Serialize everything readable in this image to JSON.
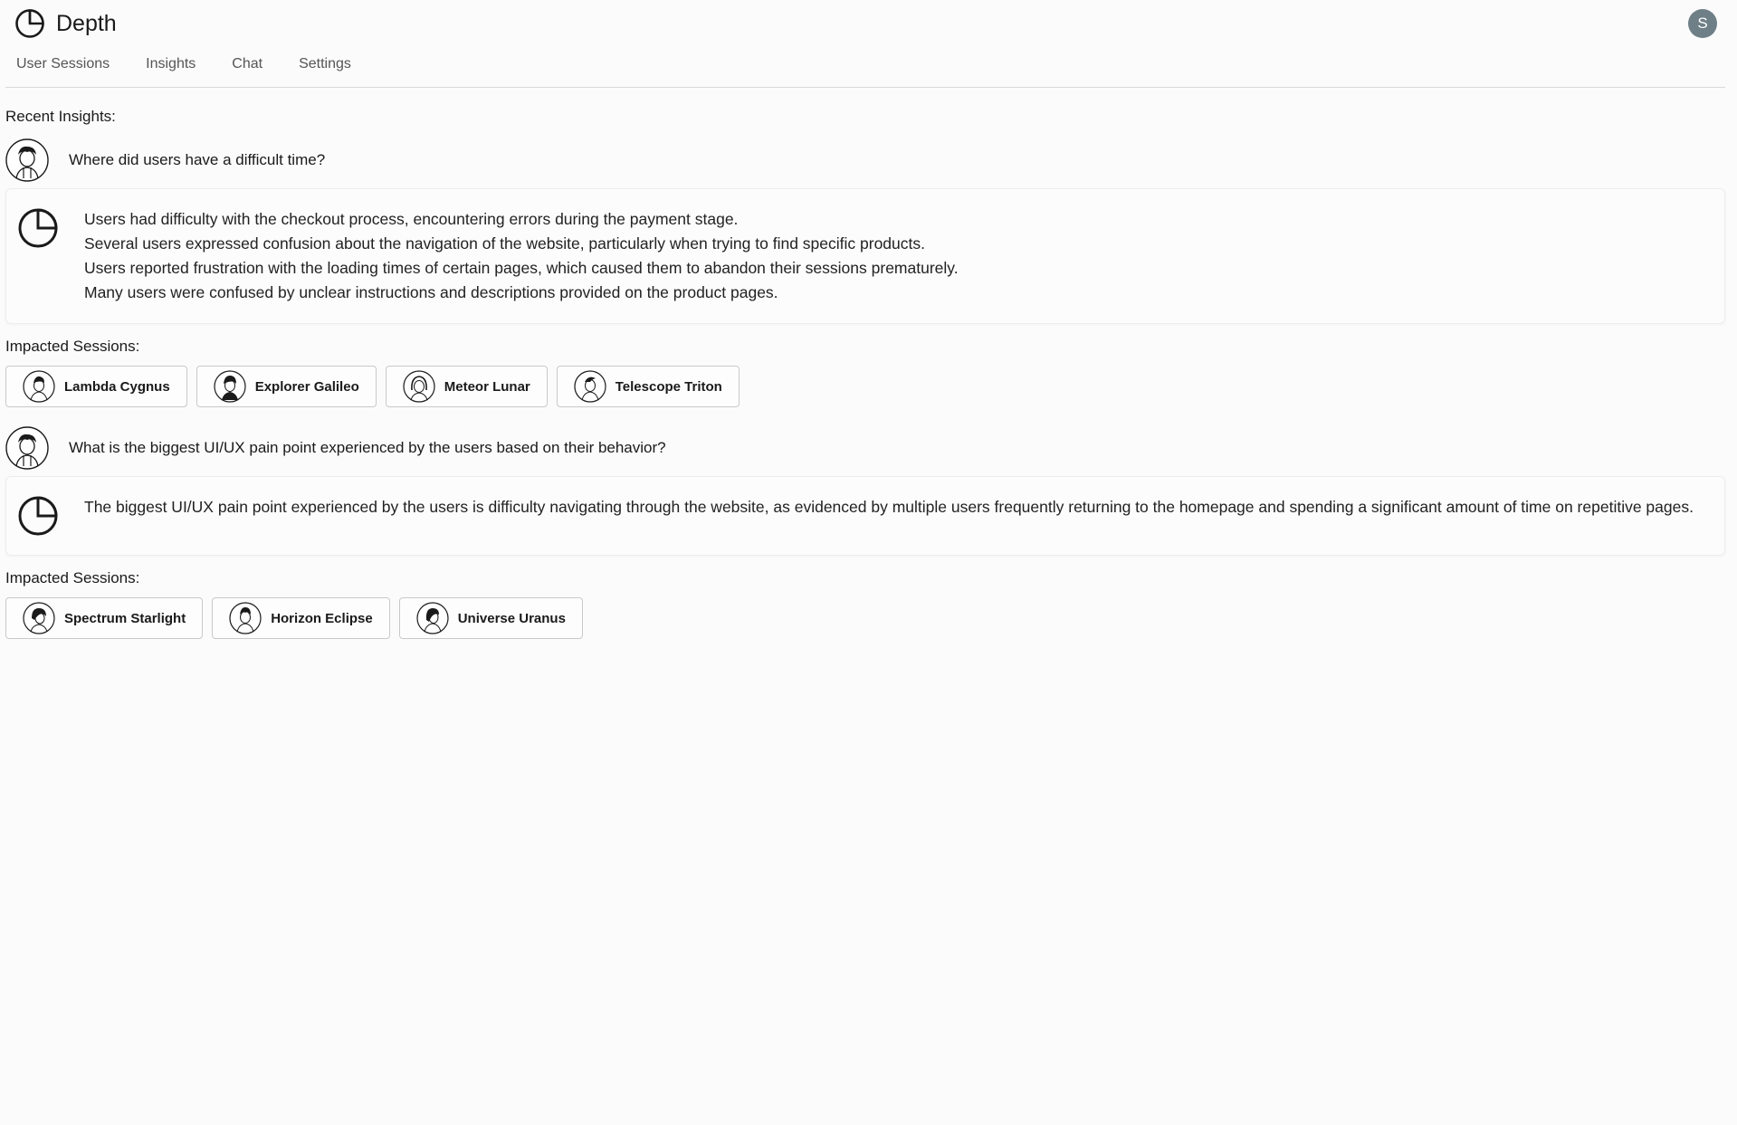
{
  "app": {
    "name": "Depth",
    "user_initial": "S"
  },
  "tabs": [
    {
      "label": "User Sessions"
    },
    {
      "label": "Insights"
    },
    {
      "label": "Chat"
    },
    {
      "label": "Settings"
    }
  ],
  "main": {
    "recent_label": "Recent Insights:",
    "insights": [
      {
        "question": "Where did users have a difficult time?",
        "answer_lines": [
          "Users had difficulty with the checkout process, encountering errors during the payment stage.",
          "Several users expressed confusion about the navigation of the website, particularly when trying to find specific products.",
          "Users reported frustration with the loading times of certain pages, which caused them to abandon their sessions prematurely.",
          "Many users were confused by unclear instructions and descriptions provided on the product pages."
        ],
        "impacted_label": "Impacted Sessions:",
        "sessions": [
          {
            "name": "Lambda Cygnus"
          },
          {
            "name": "Explorer Galileo"
          },
          {
            "name": "Meteor Lunar"
          },
          {
            "name": "Telescope Triton"
          }
        ]
      },
      {
        "question": "What is the biggest UI/UX pain point experienced by the users based on their behavior?",
        "answer_lines": [
          "The biggest UI/UX pain point experienced by the users is difficulty navigating through the website, as evidenced by multiple users frequently returning to the homepage and spending a significant amount of time on repetitive pages."
        ],
        "impacted_label": "Impacted Sessions:",
        "sessions": [
          {
            "name": "Spectrum Starlight"
          },
          {
            "name": "Horizon Eclipse"
          },
          {
            "name": "Universe Uranus"
          }
        ]
      }
    ]
  },
  "colors": {
    "avatar_bg": "#6f7f87",
    "background": "#fbfbfb",
    "border": "#c9c9c9"
  },
  "icons": {
    "logo": "depth-logo-icon",
    "user": "user-avatar-icon"
  }
}
